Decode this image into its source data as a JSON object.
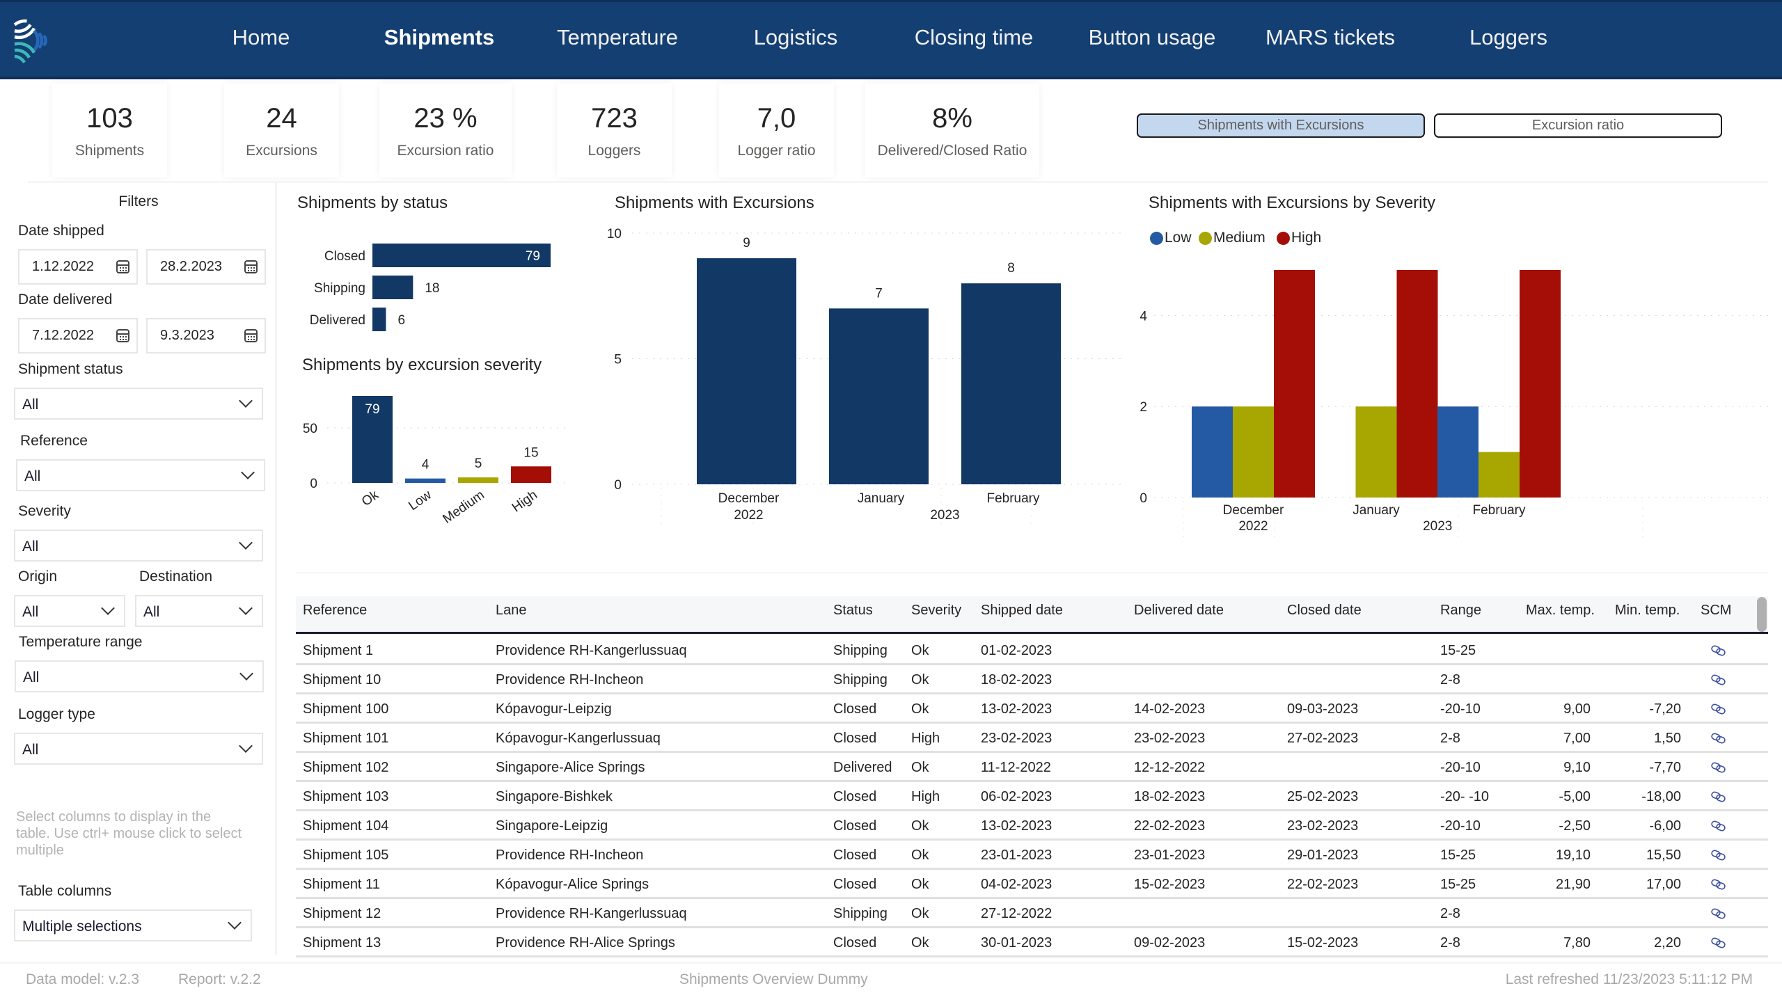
{
  "nav": {
    "items": [
      {
        "label": "Home",
        "active": false
      },
      {
        "label": "Shipments",
        "active": true
      },
      {
        "label": "Temperature",
        "active": false
      },
      {
        "label": "Logistics",
        "active": false
      },
      {
        "label": "Closing time",
        "active": false
      },
      {
        "label": "Button usage",
        "active": false
      },
      {
        "label": "MARS tickets",
        "active": false
      },
      {
        "label": "Loggers",
        "active": false
      }
    ]
  },
  "kpis": [
    {
      "value": "103",
      "label": "Shipments"
    },
    {
      "value": "24",
      "label": "Excursions"
    },
    {
      "value": "23 %",
      "label": "Excursion ratio"
    },
    {
      "value": "723",
      "label": "Loggers"
    },
    {
      "value": "7,0",
      "label": "Logger ratio"
    },
    {
      "value": "8%",
      "label": "Delivered/Closed Ratio"
    }
  ],
  "toggles": [
    {
      "label": "Shipments with Excursions",
      "selected": true
    },
    {
      "label": "Excursion ratio",
      "selected": false
    }
  ],
  "filters": {
    "title": "Filters",
    "date_shipped": {
      "label": "Date shipped",
      "from": "1.12.2022",
      "to": "28.2.2023"
    },
    "date_delivered": {
      "label": "Date delivered",
      "from": "7.12.2022",
      "to": "9.3.2023"
    },
    "shipment_status": {
      "label": "Shipment status",
      "value": "All"
    },
    "reference": {
      "label": "Reference",
      "value": "All"
    },
    "severity": {
      "label": "Severity",
      "value": "All"
    },
    "origin": {
      "label": "Origin",
      "value": "All"
    },
    "destination": {
      "label": "Destination",
      "value": "All"
    },
    "temperature_range": {
      "label": "Temperature range",
      "value": "All"
    },
    "logger_type": {
      "label": "Logger type",
      "value": "All"
    },
    "hint": "Select columns to display in the table. Use ctrl+ mouse click to select multiple",
    "table_columns": {
      "label": "Table columns",
      "value": "Multiple selections"
    }
  },
  "colors": {
    "navy": "#123865",
    "low": "#245aa3",
    "medium": "#a8a600",
    "high": "#a50e07",
    "header_bg": "#143f73"
  },
  "chart_data": [
    {
      "id": "status",
      "type": "bar",
      "orientation": "horizontal",
      "title": "Shipments by status",
      "categories": [
        "Closed",
        "Shipping",
        "Delivered"
      ],
      "values": [
        79,
        18,
        6
      ]
    },
    {
      "id": "severity",
      "type": "bar",
      "title": "Shipments by excursion severity",
      "categories": [
        "Ok",
        "Low",
        "Medium",
        "High"
      ],
      "values": [
        79,
        4,
        5,
        15
      ],
      "yticks": [
        0,
        50
      ],
      "ylim": [
        0,
        79
      ],
      "grid": true
    },
    {
      "id": "excursions",
      "type": "bar",
      "title": "Shipments with Excursions",
      "categories": [
        "December",
        "January",
        "February"
      ],
      "year_groups": [
        {
          "label": "2022",
          "span": 1
        },
        {
          "label": "2023",
          "span": 2
        }
      ],
      "values": [
        9,
        7,
        8
      ],
      "yticks": [
        0,
        5,
        10
      ],
      "ylim": [
        0,
        10
      ],
      "grid": true
    },
    {
      "id": "severity_by_month",
      "type": "bar",
      "title": "Shipments with Excursions by Severity",
      "categories": [
        "December",
        "January",
        "February"
      ],
      "year_groups": [
        {
          "label": "2022",
          "span": 1
        },
        {
          "label": "2023",
          "span": 2
        }
      ],
      "series": [
        {
          "name": "Low",
          "values": [
            2,
            0,
            2
          ]
        },
        {
          "name": "Medium",
          "values": [
            2,
            2,
            1
          ]
        },
        {
          "name": "High",
          "values": [
            5,
            5,
            5
          ]
        }
      ],
      "yticks": [
        0,
        2,
        4
      ],
      "ylim": [
        0,
        5
      ],
      "legend": "top-left",
      "grid": true
    }
  ],
  "table": {
    "columns": [
      "Reference",
      "Lane",
      "Status",
      "Severity",
      "Shipped date",
      "Delivered date",
      "Closed date",
      "Range",
      "Max. temp.",
      "Min. temp.",
      "SCM"
    ],
    "rows": [
      [
        "Shipment 1",
        "Providence RH-Kangerlussuaq",
        "Shipping",
        "Ok",
        "01-02-2023",
        "",
        "",
        "15-25",
        "",
        ""
      ],
      [
        "Shipment 10",
        "Providence RH-Incheon",
        "Shipping",
        "Ok",
        "18-02-2023",
        "",
        "",
        "2-8",
        "",
        ""
      ],
      [
        "Shipment 100",
        "Kópavogur-Leipzig",
        "Closed",
        "Ok",
        "13-02-2023",
        "14-02-2023",
        "09-03-2023",
        "-20-10",
        "9,00",
        "-7,20"
      ],
      [
        "Shipment 101",
        "Kópavogur-Kangerlussuaq",
        "Closed",
        "High",
        "23-02-2023",
        "23-02-2023",
        "27-02-2023",
        "2-8",
        "7,00",
        "1,50"
      ],
      [
        "Shipment 102",
        "Singapore-Alice Springs",
        "Delivered",
        "Ok",
        "11-12-2022",
        "12-12-2022",
        "",
        "-20-10",
        "9,10",
        "-7,70"
      ],
      [
        "Shipment 103",
        "Singapore-Bishkek",
        "Closed",
        "High",
        "06-02-2023",
        "18-02-2023",
        "25-02-2023",
        "-20- -10",
        "-5,00",
        "-18,00"
      ],
      [
        "Shipment 104",
        "Singapore-Leipzig",
        "Closed",
        "Ok",
        "13-02-2023",
        "22-02-2023",
        "23-02-2023",
        "-20-10",
        "-2,50",
        "-6,00"
      ],
      [
        "Shipment 105",
        "Providence RH-Incheon",
        "Closed",
        "Ok",
        "23-01-2023",
        "23-01-2023",
        "29-01-2023",
        "15-25",
        "19,10",
        "15,50"
      ],
      [
        "Shipment 11",
        "Kópavogur-Alice Springs",
        "Closed",
        "Ok",
        "04-02-2023",
        "15-02-2023",
        "22-02-2023",
        "15-25",
        "21,90",
        "17,00"
      ],
      [
        "Shipment 12",
        "Providence RH-Kangerlussuaq",
        "Shipping",
        "Ok",
        "27-12-2022",
        "",
        "",
        "2-8",
        "",
        ""
      ],
      [
        "Shipment 13",
        "Providence RH-Alice Springs",
        "Closed",
        "Ok",
        "30-01-2023",
        "09-02-2023",
        "15-02-2023",
        "2-8",
        "7,80",
        "2,20"
      ]
    ]
  },
  "footer": {
    "data_model": "Data model: v.2.3",
    "report": "Report: v.2.2",
    "report_name": "Shipments Overview Dummy",
    "last_refreshed": "Last refreshed 11/23/2023 5:11:12 PM"
  }
}
